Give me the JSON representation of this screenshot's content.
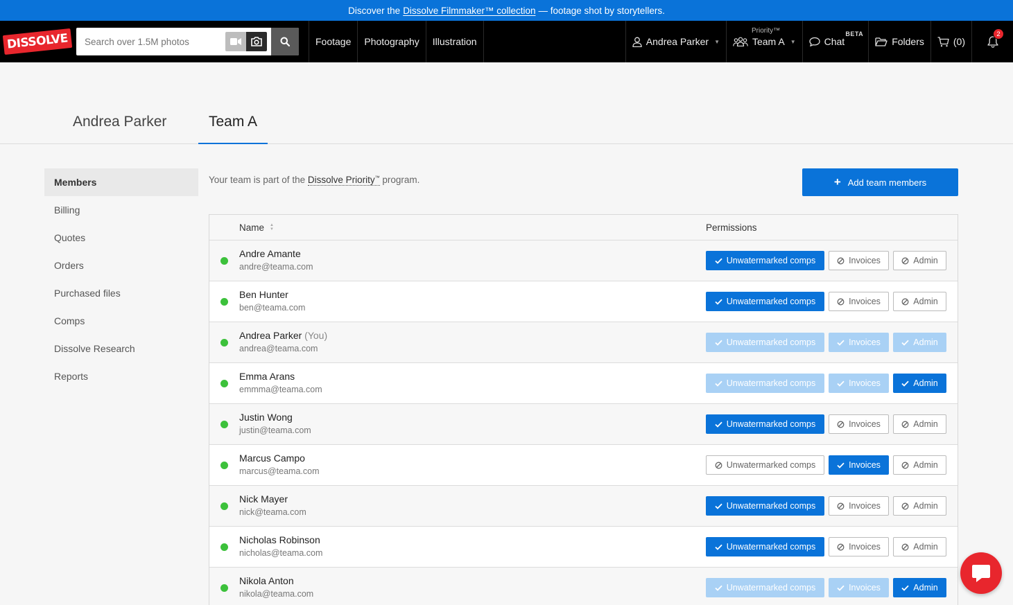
{
  "banner": {
    "prefix": "Discover the",
    "link": "Dissolve Filmmaker™ collection",
    "suffix": "— footage shot by storytellers."
  },
  "logo": {
    "text": "DISSOLVE"
  },
  "search": {
    "placeholder": "Search over 1.5M photos"
  },
  "nav": {
    "categories": [
      "Footage",
      "Photography",
      "Illustration"
    ],
    "user": "Andrea Parker",
    "team_small": "Priority™",
    "team": "Team A",
    "chat": "Chat",
    "chat_badge": "BETA",
    "folders": "Folders",
    "cart": "(0)",
    "notifications": "2"
  },
  "tabs": [
    "Andrea Parker",
    "Team A"
  ],
  "sidebar": [
    "Members",
    "Billing",
    "Quotes",
    "Orders",
    "Purchased files",
    "Comps",
    "Dissolve Research",
    "Reports"
  ],
  "intro": {
    "prefix": "Your team is part of the",
    "program": "Dissolve Priority",
    "tm": "™",
    "suffix": "program."
  },
  "add_button": "Add team members",
  "table": {
    "col_name": "Name",
    "col_permissions": "Permissions",
    "perm_labels": [
      "Unwatermarked comps",
      "Invoices",
      "Admin"
    ],
    "rows": [
      {
        "name": "Andre Amante",
        "you": "",
        "email": "andre@teama.com",
        "perms": [
          "on",
          "off",
          "off"
        ]
      },
      {
        "name": "Ben Hunter",
        "you": "",
        "email": "ben@teama.com",
        "perms": [
          "on",
          "off",
          "off"
        ]
      },
      {
        "name": "Andrea Parker",
        "you": "(You)",
        "email": "andrea@teama.com",
        "perms": [
          "dis",
          "dis",
          "dis"
        ]
      },
      {
        "name": "Emma Arans",
        "you": "",
        "email": "emmma@teama.com",
        "perms": [
          "dis",
          "dis",
          "on"
        ]
      },
      {
        "name": "Justin Wong",
        "you": "",
        "email": "justin@teama.com",
        "perms": [
          "on",
          "off",
          "off"
        ]
      },
      {
        "name": "Marcus Campo",
        "you": "",
        "email": "marcus@teama.com",
        "perms": [
          "off",
          "on",
          "off"
        ]
      },
      {
        "name": "Nick Mayer",
        "you": "",
        "email": "nick@teama.com",
        "perms": [
          "on",
          "off",
          "off"
        ]
      },
      {
        "name": "Nicholas Robinson",
        "you": "",
        "email": "nicholas@teama.com",
        "perms": [
          "on",
          "off",
          "off"
        ]
      },
      {
        "name": "Nikola Anton",
        "you": "",
        "email": "nikola@teama.com",
        "perms": [
          "dis",
          "dis",
          "on"
        ]
      }
    ]
  }
}
